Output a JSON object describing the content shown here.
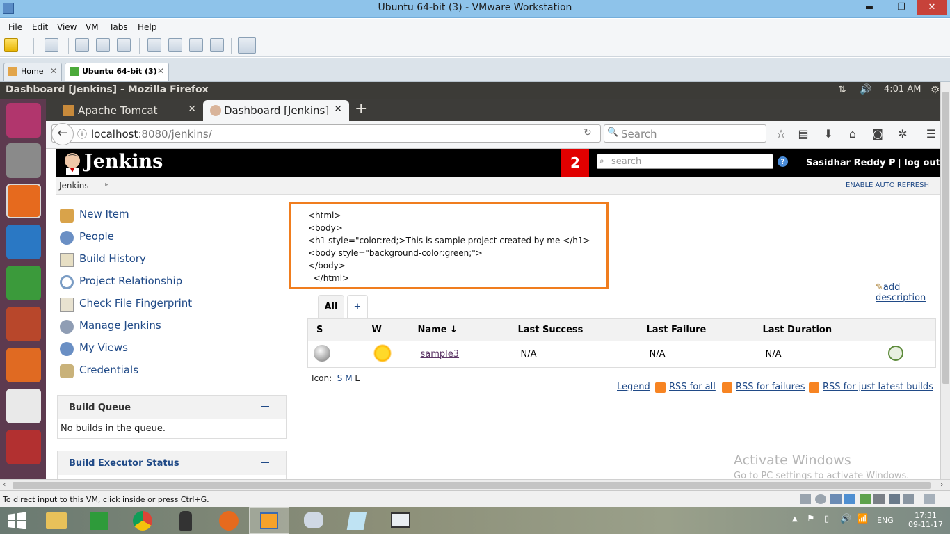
{
  "vmware": {
    "title": "Ubuntu 64-bit (3) - VMware Workstation",
    "menu": [
      "File",
      "Edit",
      "View",
      "VM",
      "Tabs",
      "Help"
    ],
    "tabs": [
      {
        "label": "Home",
        "close": "✕"
      },
      {
        "label": "Ubuntu 64-bit (3)",
        "close": "✕"
      }
    ],
    "status_text": "To direct input to this VM, click inside or press Ctrl+G."
  },
  "ubuntu": {
    "window_title": "Dashboard [Jenkins] - Mozilla Firefox",
    "clock": "4:01 AM"
  },
  "firefox": {
    "tabs": [
      {
        "label": "Apache Tomcat",
        "close": "✕"
      },
      {
        "label": "Dashboard [Jenkins]",
        "close": "✕"
      }
    ],
    "new_tab": "+",
    "url_host": "localhost",
    "url_rest": ":8080/jenkins/",
    "search_placeholder": "Search"
  },
  "jenkins": {
    "logo": "Jenkins",
    "notification_count": "2",
    "search_placeholder": "search",
    "help": "?",
    "user": "Sasidhar Reddy P",
    "logout": "| log out",
    "breadcrumb": "Jenkins",
    "auto_refresh": "ENABLE AUTO REFRESH",
    "tasks": [
      "New Item",
      "People",
      "Build History",
      "Project Relationship",
      "Check File Fingerprint",
      "Manage Jenkins",
      "My Views",
      "Credentials"
    ],
    "build_queue": {
      "title": "Build Queue",
      "empty": "No builds in the queue."
    },
    "executor": {
      "title": "Build Executor Status"
    },
    "description_lines": [
      "<html>",
      "<body>",
      "<h1 style=\"color:red;>This is sample project created by me </h1>",
      "<body style=\"background-color:green;\">",
      "</body>",
      "  </html>"
    ],
    "add_description": "add description",
    "view_tabs": {
      "all": "All",
      "add": "+"
    },
    "table": {
      "headers": {
        "s": "S",
        "w": "W",
        "name": "Name  ↓",
        "last_success": "Last Success",
        "last_failure": "Last Failure",
        "last_duration": "Last Duration"
      },
      "rows": [
        {
          "name": "sample3",
          "last_success": "N/A",
          "last_failure": "N/A",
          "last_duration": "N/A"
        }
      ]
    },
    "icon_label": "Icon:",
    "icon_sizes": [
      "S",
      "M",
      "L"
    ],
    "legend": "Legend",
    "rss_all": "RSS for all",
    "rss_failures": "RSS for failures",
    "rss_latest": "RSS for just latest builds"
  },
  "watermark": {
    "line1": "Activate Windows",
    "line2": "Go to PC settings to activate Windows."
  },
  "taskbar": {
    "lang": "ENG",
    "time": "17:31",
    "date": "09-11-17"
  },
  "colors": {
    "jenkins_header": "#000000",
    "notification": "#e10000",
    "description_border": "#f07d1e",
    "link": "#204a87",
    "launcher": "#5d3a4f"
  }
}
